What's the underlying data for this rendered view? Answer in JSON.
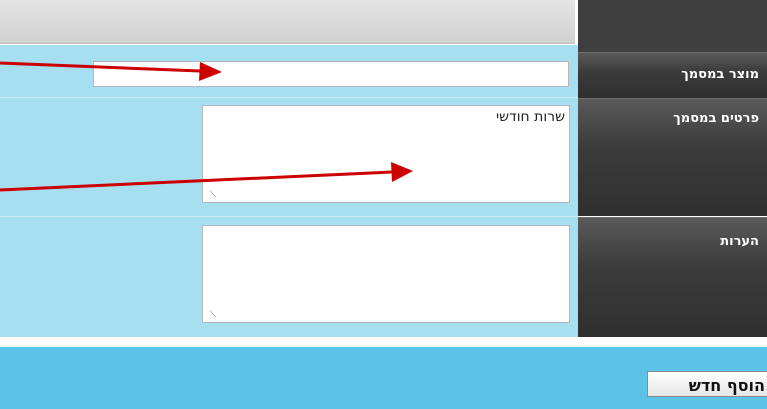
{
  "form": {
    "rows": [
      {
        "label": "מוצר במסמך",
        "value": "",
        "type": "text"
      },
      {
        "label": "פרטים במסמך",
        "value": "שרות חודשי",
        "type": "textarea"
      },
      {
        "label": "הערות",
        "value": "",
        "type": "textarea"
      }
    ]
  },
  "footer": {
    "add_button_label": "הוסף חדש"
  },
  "colors": {
    "form_background": "#a5dff0",
    "label_background": "#3f3f3f",
    "footer_background": "#5bc3e6",
    "annotation_arrow": "#cc0000"
  },
  "annotations": {
    "arrow_icon": "red-arrow-icon"
  }
}
